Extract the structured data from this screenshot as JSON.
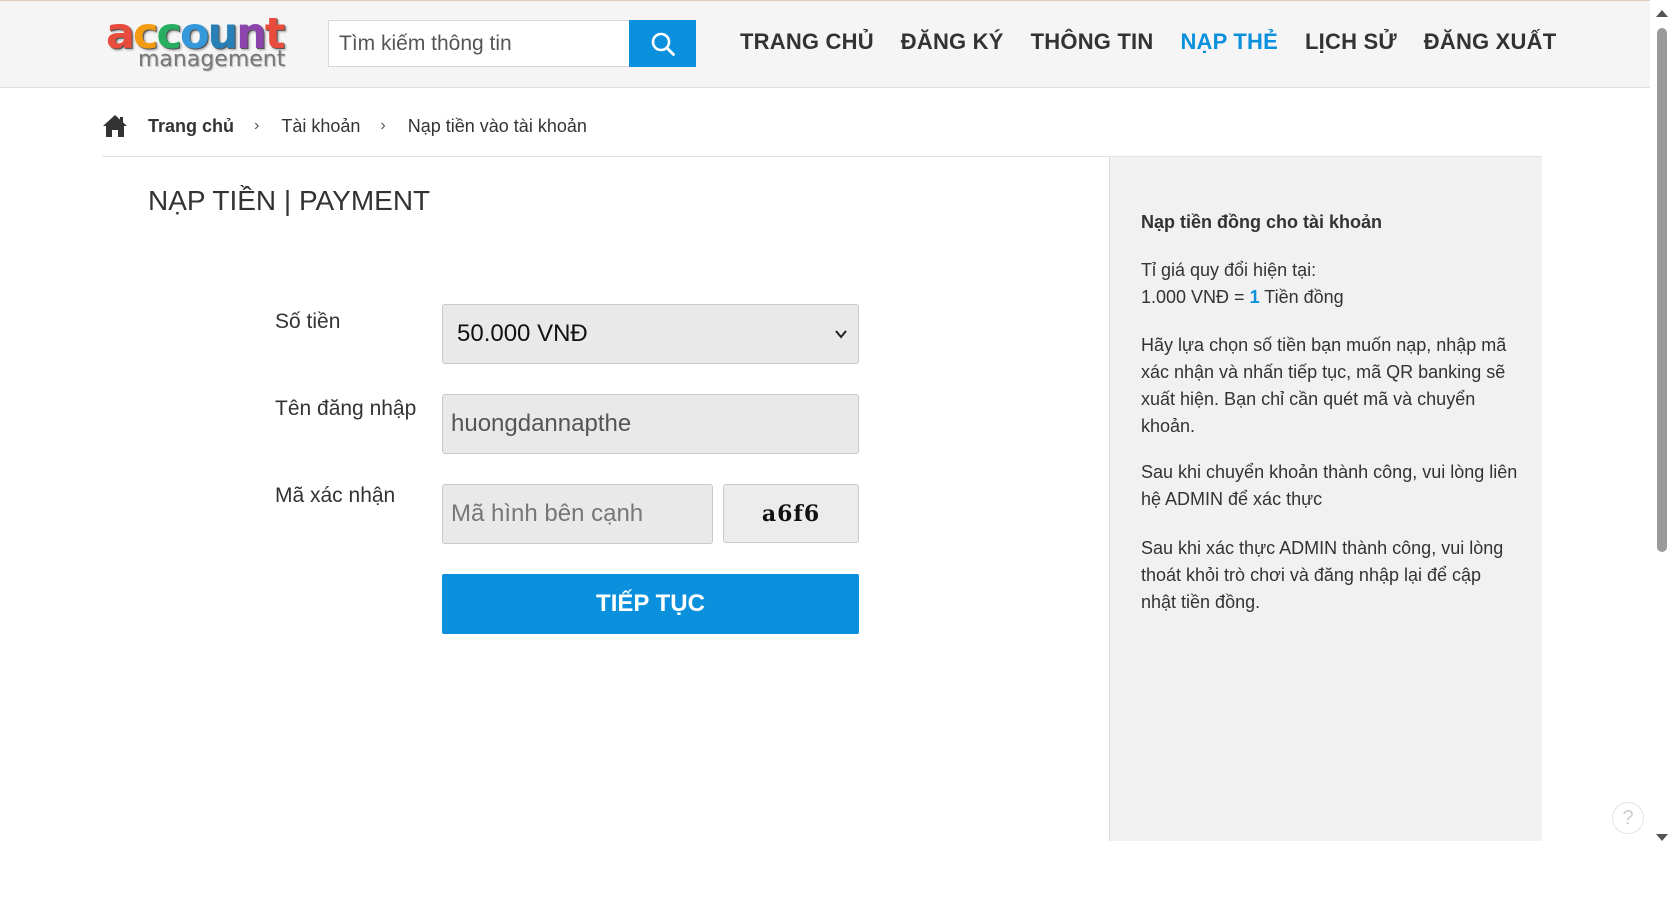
{
  "header": {
    "logo_top": "account",
    "logo_bottom": "management",
    "search_placeholder": "Tìm kiếm thông tin",
    "nav": [
      {
        "label": "TRANG CHỦ",
        "active": false
      },
      {
        "label": "ĐĂNG KÝ",
        "active": false
      },
      {
        "label": "THÔNG TIN",
        "active": false
      },
      {
        "label": "NẠP THẺ",
        "active": true
      },
      {
        "label": "LỊCH SỬ",
        "active": false
      },
      {
        "label": "ĐĂNG XUẤT",
        "active": false
      }
    ]
  },
  "breadcrumb": {
    "home": "Trang chủ",
    "account": "Tài khoản",
    "current": "Nạp tiền vào tài khoản"
  },
  "main": {
    "title": "NẠP TIỀN | PAYMENT",
    "amount_label": "Số tiền",
    "amount_selected": "50.000 VNĐ",
    "username_label": "Tên đăng nhập",
    "username_value": "huongdannapthe",
    "captcha_label": "Mã xác nhận",
    "captcha_placeholder": "Mã hình bên cạnh",
    "captcha_code": "a6f6",
    "submit_label": "TIẾP TỤC"
  },
  "sidebar": {
    "title": "Nạp tiền đồng cho tài khoản",
    "rate_line1": "Tỉ giá quy đổi hiện tại:",
    "rate_prefix": "1.000 VNĐ = ",
    "rate_value": "1",
    "rate_suffix": " Tiền đồng",
    "para1": "Hãy lựa chọn số tiền bạn muốn nạp, nhập mã xác nhận và nhấn tiếp tục, mã QR banking sẽ xuất hiện. Bạn chỉ cần quét mã và chuyển khoản.",
    "para2": "Sau khi chuyển khoản thành công, vui lòng liên hệ ADMIN để xác thực",
    "para3": "Sau khi xác thực ADMIN thành công, vui lòng thoát khỏi trò chơi và đăng nhập lại để cập nhật tiền đồng."
  },
  "colors": {
    "accent": "#0a90dc",
    "logo_a": "#e84c3d",
    "logo_c1": "#f39c12",
    "logo_c2": "#27ae60",
    "logo_o": "#3498db",
    "logo_u": "#2980b9",
    "logo_n": "#8e44ad",
    "logo_t": "#e74c3c"
  },
  "icons": {
    "search": "search-icon",
    "home": "home-icon",
    "chevron": "chevron-down-icon",
    "help": "help-icon"
  },
  "help_glyph": "?"
}
